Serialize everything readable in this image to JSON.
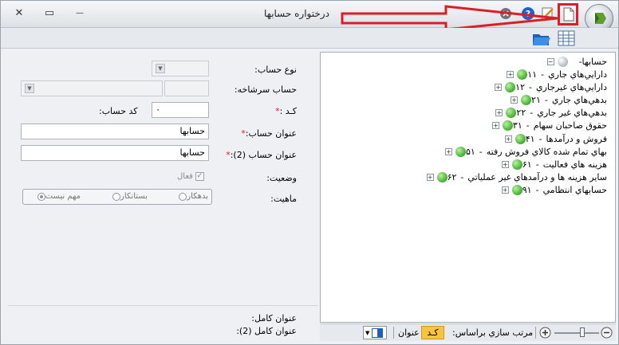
{
  "window": {
    "title": "درختواره حسابها",
    "close_glyph": "✕",
    "restore_glyph": "▭",
    "minimize_glyph": "—"
  },
  "toolbar": {
    "new_doc_icon": "new-document-icon",
    "edit_icon": "edit-icon",
    "help_icon": "help-icon",
    "info_icon": "info-icon"
  },
  "tree": {
    "root": {
      "label": "حسابها",
      "prefix": "-"
    },
    "items": [
      {
        "code": "۱۱",
        "label": "دارايي‌هاي جاري"
      },
      {
        "code": "۱۲",
        "label": "دارايي‌هاي غيرجاري"
      },
      {
        "code": "۲۱",
        "label": "بدهي‌هاي جاري"
      },
      {
        "code": "۲۲",
        "label": "بدهي‌هاي غير جاري"
      },
      {
        "code": "۳۱",
        "label": "حقوق صاحبان سهام"
      },
      {
        "code": "۴۱",
        "label": "فروش و درآمدها"
      },
      {
        "code": "۵۱",
        "label": "بهاي تمام شده کالاي فروش رفته"
      },
      {
        "code": "۶۱",
        "label": "هزينه هاي فعاليت"
      },
      {
        "code": "۶۲",
        "label": "ساير هزينه ها و درآمدهاي غير عملياتي"
      },
      {
        "code": "۹۱",
        "label": "حسابهاي انتظامي"
      }
    ]
  },
  "form": {
    "account_type_label": "نوع حساب:",
    "parent_account_label": "حساب سرشاخه:",
    "code_label": "کـد :",
    "account_code_label": "کد حساب:",
    "account_code_value": "۰",
    "title_label": "عنوان حساب:",
    "title_value": "حسابها",
    "title2_label": "عنوان حساب (2):",
    "title2_value": "حسابها",
    "status_label": "وضعيت:",
    "active_label": "فعال",
    "nature_label": "ماهيت:",
    "nature_options": {
      "debit": "بدهکار",
      "credit": "بستانکار",
      "none": "مهم نيست"
    },
    "full_title_label": "عنوان کامل:",
    "full_title2_label": "عنوان کامل (2):"
  },
  "statusbar": {
    "sort_label": "مرتب سازي براساس:",
    "sort_code": "کـد",
    "sort_title": "عنوان"
  },
  "colors": {
    "highlight": "#e01b24",
    "accent_sort": "#f6c343"
  }
}
